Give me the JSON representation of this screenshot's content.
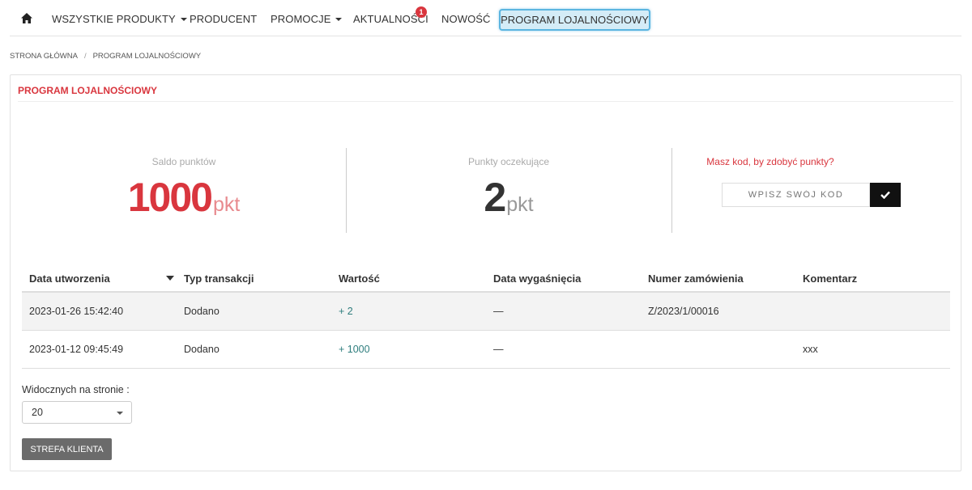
{
  "nav": {
    "home_icon": "home-icon",
    "items": [
      {
        "label": "WSZYSTKIE PRODUKTY",
        "has_dropdown": true
      },
      {
        "label": "PRODUCENT",
        "has_dropdown": false
      },
      {
        "label": "PROMOCJE",
        "has_dropdown": true
      },
      {
        "label": "AKTUALNOŚCI",
        "has_dropdown": false,
        "badge": "1"
      },
      {
        "label": "NOWOŚĆ",
        "has_dropdown": false
      },
      {
        "label": "PROGRAM LOJALNOŚCIOWY",
        "active": true
      }
    ]
  },
  "breadcrumb": {
    "home": "STRONA GŁÓWNA",
    "separator": "/",
    "current": "PROGRAM LOJALNOŚCIOWY"
  },
  "panel": {
    "title": "PROGRAM LOJALNOŚCIOWY"
  },
  "stats": {
    "balance_label": "Saldo punktów",
    "balance_value": "1000",
    "balance_unit": "pkt",
    "pending_label": "Punkty oczekujące",
    "pending_value": "2",
    "pending_unit": "pkt"
  },
  "code": {
    "label": "Masz kod, by zdobyć punkty?",
    "placeholder": "WPISZ SWÓJ KOD",
    "submit_icon": "check-icon"
  },
  "table": {
    "headers": [
      "Data utworzenia",
      "Typ transakcji",
      "Wartość",
      "Data wygaśnięcia",
      "Numer zamówienia",
      "Komentarz"
    ],
    "rows": [
      {
        "date": "2023-01-26 15:42:40",
        "type": "Dodano",
        "value": "+ 2",
        "expiry": "—",
        "order": "Z/2023/1/00016",
        "comment": ""
      },
      {
        "date": "2023-01-12 09:45:49",
        "type": "Dodano",
        "value": "+ 1000",
        "expiry": "—",
        "order": "",
        "comment": "xxx"
      }
    ]
  },
  "pagination": {
    "per_page_label": "Widocznych na stronie :",
    "per_page_value": "20"
  },
  "client_zone_button": "STREFA KLIENTA",
  "colors": {
    "accent_red": "#d9363e",
    "active_nav_bg": "#d4ecf7",
    "active_nav_border": "#5bb5e0",
    "value_link": "#2e7d7d"
  }
}
